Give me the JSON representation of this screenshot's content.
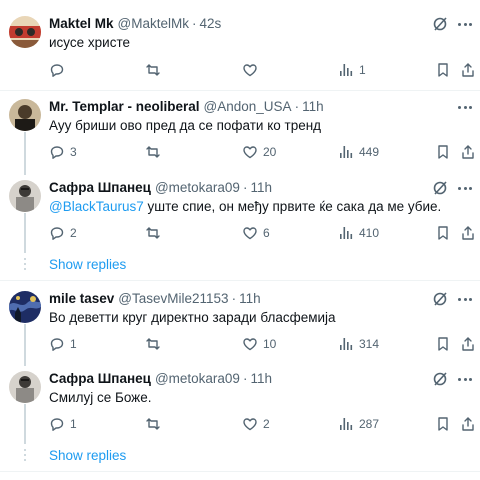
{
  "posts": [
    {
      "name": "Maktel Mk",
      "handle": "@MaktelMk",
      "time": "42s",
      "text": "исусе христе",
      "replies": "",
      "retweets": "",
      "likes": "",
      "views": "1",
      "avatar_colors": [
        "#c23b2f",
        "#e9d6b7",
        "#2d2a27"
      ]
    },
    {
      "name": "Mr. Templar - neoliberal",
      "handle": "@Andon_USA",
      "time": "11h",
      "text": "Ауу бриши ово пред да се пофати ко тренд",
      "replies": "3",
      "retweets": "",
      "likes": "20",
      "views": "449",
      "avatar_colors": [
        "#4a3b2a",
        "#c9b89a",
        "#1d1a16"
      ]
    },
    {
      "name": "Сафра Шпанец",
      "handle": "@metokara09",
      "time": "11h",
      "mention": "@BlackTaurus7",
      "text": " уште спие, он међу првите ќе сака да ме убие.",
      "replies": "2",
      "retweets": "",
      "likes": "6",
      "views": "410",
      "avatar_colors": [
        "#8d8a86",
        "#3d3a37",
        "#d6d2cc"
      ]
    },
    {
      "name": "mile tasev",
      "handle": "@TasevMile21153",
      "time": "11h",
      "text": "Во деветти круг директно заради бласфемија",
      "replies": "1",
      "retweets": "",
      "likes": "10",
      "views": "314",
      "avatar_colors": [
        "#1e2d64",
        "#4f6db0",
        "#e3c35a"
      ]
    },
    {
      "name": "Сафра Шпанец",
      "handle": "@metokara09",
      "time": "11h",
      "text": "Смилуј се Боже.",
      "replies": "1",
      "retweets": "",
      "likes": "2",
      "views": "287",
      "avatar_colors": [
        "#8d8a86",
        "#3d3a37",
        "#d6d2cc"
      ]
    }
  ],
  "show_replies_label": "Show replies",
  "separator": "·",
  "colors": {
    "accent": "#1d9bf0",
    "muted": "#536471",
    "text": "#0f1419",
    "divider": "#eff3f4"
  }
}
